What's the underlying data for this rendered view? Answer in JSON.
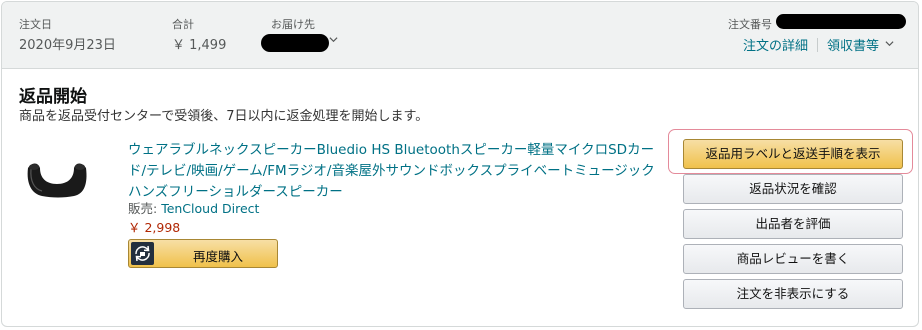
{
  "header": {
    "order_date_label": "注文日",
    "order_date": "2020年9月23日",
    "total_label": "合計",
    "total": "￥ 1,499",
    "ship_to_label": "お届け先",
    "order_number_label": "注文番号",
    "order_details_link": "注文の詳細",
    "invoice_link": "領収書等"
  },
  "section": {
    "title": "返品開始",
    "subtitle": "商品を返品受付センターで受領後、7日以内に返金処理を開始します。"
  },
  "product": {
    "name": "ウェアラブルネックスピーカーBluedio HS Bluetoothスピーカー軽量マイクロSDカード/テレビ/映画/ゲーム/FMラジオ/音楽屋外サウンドボックスプライベートミュージックハンズフリーショルダースピーカー",
    "seller_label": "販売: ",
    "seller": "TenCloud Direct",
    "price": "￥ 2,998",
    "rebuy_label": "再度購入"
  },
  "actions": [
    {
      "label": "返品用ラベルと返送手順を表示"
    },
    {
      "label": "返品状況を確認"
    },
    {
      "label": "出品者を評価"
    },
    {
      "label": "商品レビューを書く"
    },
    {
      "label": "注文を非表示にする"
    }
  ],
  "colors": {
    "link": "#007185",
    "price": "#b12704",
    "primary_button": "#f0c14b",
    "highlight": "#e48a9a"
  },
  "icons": {
    "ship_to": "chevron-down-icon",
    "invoice": "chevron-down-icon",
    "rebuy": "rebuy-icon"
  }
}
